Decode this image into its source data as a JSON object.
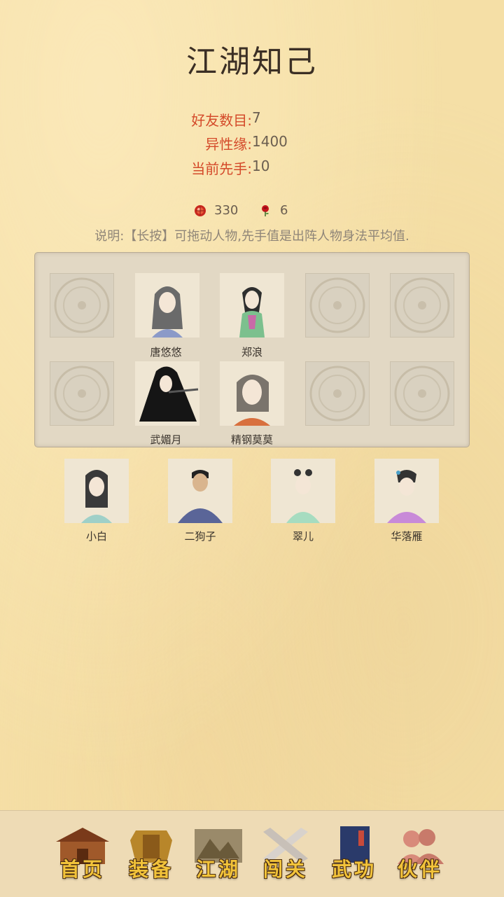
{
  "page": {
    "title": "江湖知己"
  },
  "stats": [
    {
      "label": "好友数目:",
      "value": "7"
    },
    {
      "label": "异性缘:",
      "value": "1400"
    },
    {
      "label": "当前先手:",
      "value": "10"
    }
  ],
  "currency": [
    {
      "icon": "gem-icon",
      "value": "330"
    },
    {
      "icon": "rose-icon",
      "value": "6"
    }
  ],
  "note": "说明:【长按】可拖动人物,先手值是出阵人物身法平均值.",
  "formation": {
    "row1": [
      {
        "filled": false,
        "name": ""
      },
      {
        "filled": true,
        "name": "唐悠悠"
      },
      {
        "filled": true,
        "name": "郑浪"
      },
      {
        "filled": false,
        "name": ""
      },
      {
        "filled": false,
        "name": ""
      }
    ],
    "row2": [
      {
        "filled": false,
        "name": ""
      },
      {
        "filled": true,
        "name": "武媚月"
      },
      {
        "filled": true,
        "name": "精钢莫莫"
      },
      {
        "filled": false,
        "name": ""
      },
      {
        "filled": false,
        "name": ""
      }
    ]
  },
  "reserve": [
    {
      "name": "小白"
    },
    {
      "name": "二狗子"
    },
    {
      "name": "翠儿"
    },
    {
      "name": "华落雁"
    }
  ],
  "tabs": [
    {
      "label": "首页",
      "icon": "house-icon"
    },
    {
      "label": "装备",
      "icon": "armor-icon"
    },
    {
      "label": "江湖",
      "icon": "map-scroll-icon"
    },
    {
      "label": "闯关",
      "icon": "crossed-swords-icon"
    },
    {
      "label": "武功",
      "icon": "martial-book-icon"
    },
    {
      "label": "伙伴",
      "icon": "partners-icon",
      "active": true
    }
  ],
  "colors": {
    "stat_label": "#d44a2a",
    "tab_text": "#f2c33a",
    "background": "#f5dfa6"
  }
}
